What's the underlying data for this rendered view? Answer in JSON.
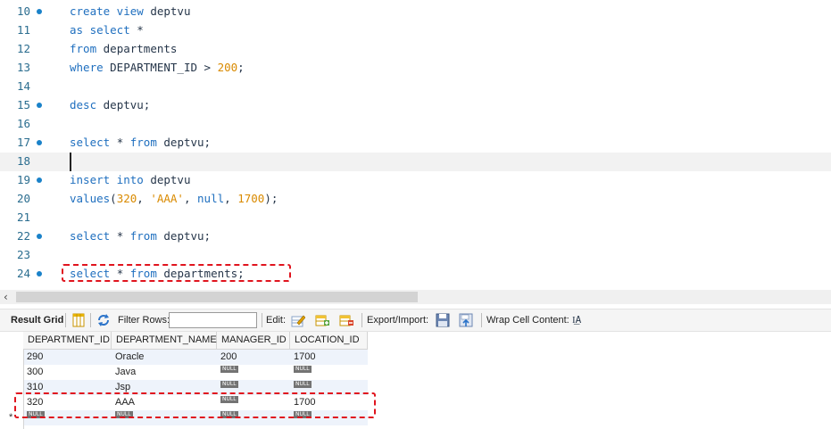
{
  "editor": {
    "lines": [
      {
        "num": "10",
        "dot": true,
        "tokens": [
          {
            "t": "create view ",
            "c": "kw"
          },
          {
            "t": "deptvu",
            "c": ""
          }
        ]
      },
      {
        "num": "11",
        "dot": false,
        "tokens": [
          {
            "t": "as select ",
            "c": "kw"
          },
          {
            "t": "*",
            "c": ""
          }
        ]
      },
      {
        "num": "12",
        "dot": false,
        "tokens": [
          {
            "t": "from ",
            "c": "kw"
          },
          {
            "t": "departments",
            "c": ""
          }
        ]
      },
      {
        "num": "13",
        "dot": false,
        "tokens": [
          {
            "t": "where ",
            "c": "kw"
          },
          {
            "t": "DEPARTMENT_ID > ",
            "c": ""
          },
          {
            "t": "200",
            "c": "num"
          },
          {
            "t": ";",
            "c": ""
          }
        ]
      },
      {
        "num": "14",
        "dot": false,
        "tokens": []
      },
      {
        "num": "15",
        "dot": true,
        "tokens": [
          {
            "t": "desc ",
            "c": "kw"
          },
          {
            "t": "deptvu;",
            "c": ""
          }
        ]
      },
      {
        "num": "16",
        "dot": false,
        "tokens": []
      },
      {
        "num": "17",
        "dot": true,
        "tokens": [
          {
            "t": "select ",
            "c": "kw"
          },
          {
            "t": "* ",
            "c": ""
          },
          {
            "t": "from ",
            "c": "kw"
          },
          {
            "t": "deptvu;",
            "c": ""
          }
        ]
      },
      {
        "num": "18",
        "dot": false,
        "tokens": [],
        "current": true
      },
      {
        "num": "19",
        "dot": true,
        "tokens": [
          {
            "t": "insert into ",
            "c": "kw"
          },
          {
            "t": "deptvu",
            "c": ""
          }
        ]
      },
      {
        "num": "20",
        "dot": false,
        "tokens": [
          {
            "t": "values",
            "c": "kw"
          },
          {
            "t": "(",
            "c": ""
          },
          {
            "t": "320",
            "c": "num"
          },
          {
            "t": ", ",
            "c": ""
          },
          {
            "t": "'AAA'",
            "c": "str"
          },
          {
            "t": ", ",
            "c": ""
          },
          {
            "t": "null",
            "c": "kw"
          },
          {
            "t": ", ",
            "c": ""
          },
          {
            "t": "1700",
            "c": "num"
          },
          {
            "t": ");",
            "c": ""
          }
        ]
      },
      {
        "num": "21",
        "dot": false,
        "tokens": []
      },
      {
        "num": "22",
        "dot": true,
        "tokens": [
          {
            "t": "select ",
            "c": "kw"
          },
          {
            "t": "* ",
            "c": ""
          },
          {
            "t": "from ",
            "c": "kw"
          },
          {
            "t": "deptvu;",
            "c": ""
          }
        ]
      },
      {
        "num": "23",
        "dot": false,
        "tokens": []
      },
      {
        "num": "24",
        "dot": true,
        "tokens": [
          {
            "t": "select ",
            "c": "kw"
          },
          {
            "t": "* ",
            "c": ""
          },
          {
            "t": "from ",
            "c": "kw"
          },
          {
            "t": "departments;",
            "c": ""
          }
        ]
      }
    ]
  },
  "toolbar": {
    "result_grid": "Result Grid",
    "filter_rows": "Filter Rows:",
    "filter_value": "",
    "edit": "Edit:",
    "export_import": "Export/Import:",
    "wrap_cell": "Wrap Cell Content:",
    "wrap_icon_glyph": "I͟A"
  },
  "grid": {
    "columns": [
      "DEPARTMENT_ID",
      "DEPARTMENT_NAME",
      "MANAGER_ID",
      "LOCATION_ID"
    ],
    "rows": [
      [
        "290",
        "Oracle",
        "200",
        "1700"
      ],
      [
        "300",
        "Java",
        null,
        null
      ],
      [
        "310",
        "Jsp",
        null,
        null
      ],
      [
        "320",
        "AAA",
        null,
        "1700"
      ],
      [
        null,
        null,
        null,
        null
      ]
    ],
    "null_label": "NULL",
    "new_row_marker": "*"
  },
  "colors": {
    "keyword": "#1f6fbf",
    "number": "#d98a00",
    "highlight_box": "#e0141e"
  }
}
